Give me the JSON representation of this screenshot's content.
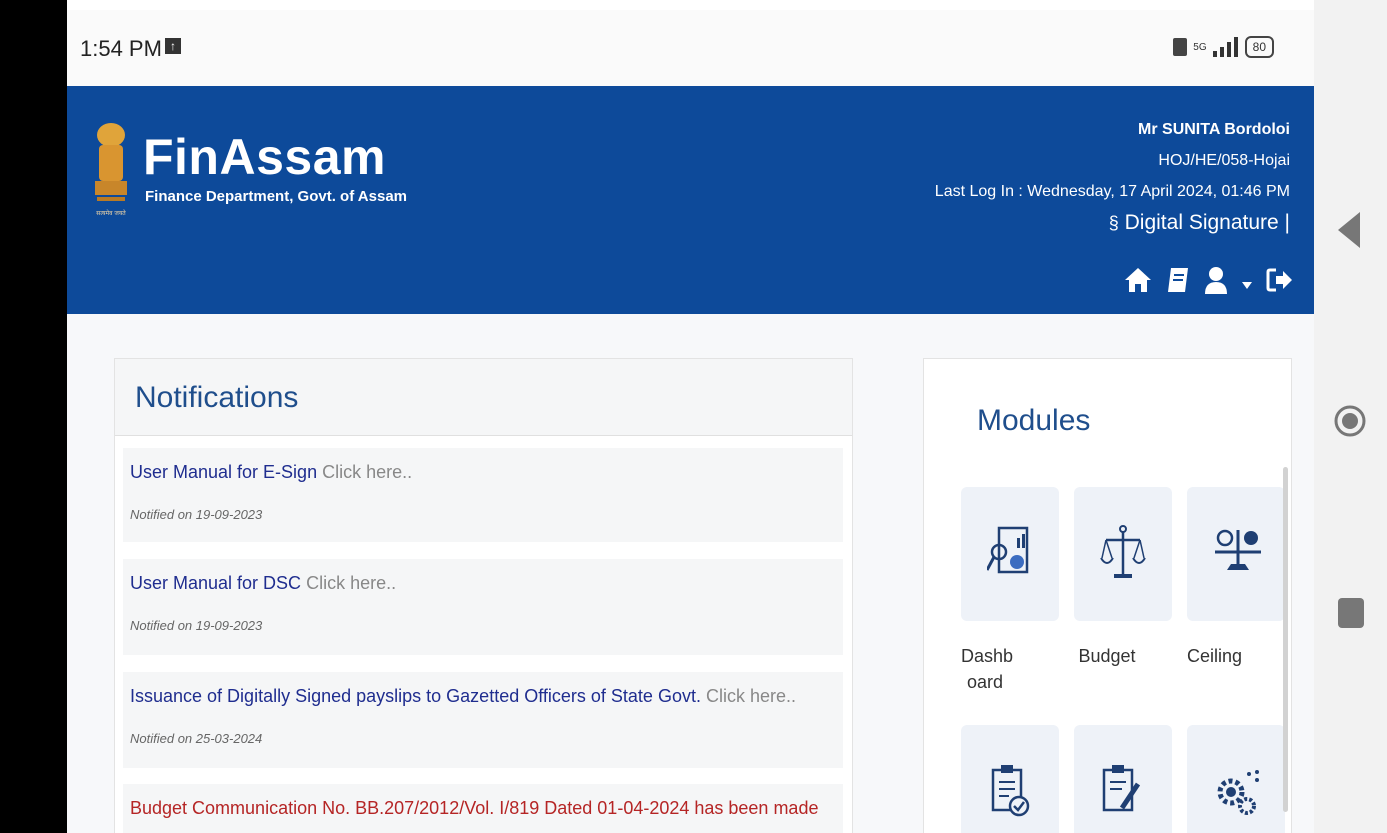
{
  "status_bar": {
    "time": "1:54 PM",
    "network": "5G",
    "battery": "80"
  },
  "header": {
    "brand_name": "FinAssam",
    "brand_subtitle": "Finance Department, Govt. of Assam",
    "emblem_caption": "सत्यमेव जयते",
    "user_name": "Mr SUNITA Bordoloi",
    "office_code": "HOJ/HE/058-Hojai",
    "last_login": "Last Log In : Wednesday, 17 April 2024, 01:46 PM",
    "digital_signature": "Digital Signature |",
    "icons": [
      "home-icon",
      "book-icon",
      "user-icon",
      "caret-down-icon",
      "logout-icon"
    ],
    "colors": {
      "background": "#0d4a9a",
      "text": "#ffffff"
    }
  },
  "notifications": {
    "title": "Notifications",
    "items": [
      {
        "text": "User Manual for E-Sign",
        "link": "Click here..",
        "date": "Notified on 19-09-2023"
      },
      {
        "text": "User Manual for DSC",
        "link": "Click here..",
        "date": "Notified on 19-09-2023"
      },
      {
        "text": "Issuance of Digitally Signed payslips to Gazetted Officers of State Govt.",
        "link": "Click here..",
        "date": "Notified on 25-03-2024"
      },
      {
        "text": "Budget Communication No. BB.207/2012/Vol. I/819 Dated 01-04-2024 has been made",
        "link": "",
        "date": ""
      }
    ],
    "colors": {
      "title": "#1f4e8c",
      "text": "#1f2d8f",
      "alert": "#b52525",
      "link": "#888888"
    }
  },
  "modules": {
    "title": "Modules",
    "items": [
      {
        "label_line1": "Dashb",
        "label_line2": "oard",
        "icon": "dashboard-icon"
      },
      {
        "label_line1": "Budget",
        "label_line2": "",
        "icon": "budget-scale-icon"
      },
      {
        "label_line1": "Ceiling",
        "label_line2": "",
        "icon": "ceiling-scale-icon"
      },
      {
        "label_line1": "",
        "label_line2": "",
        "icon": "checklist-icon"
      },
      {
        "label_line1": "",
        "label_line2": "",
        "icon": "edit-document-icon"
      },
      {
        "label_line1": "",
        "label_line2": "",
        "icon": "settings-gears-icon"
      }
    ]
  },
  "android_nav": {
    "icons": [
      "back-icon",
      "home-circle-icon",
      "recents-icon"
    ]
  }
}
